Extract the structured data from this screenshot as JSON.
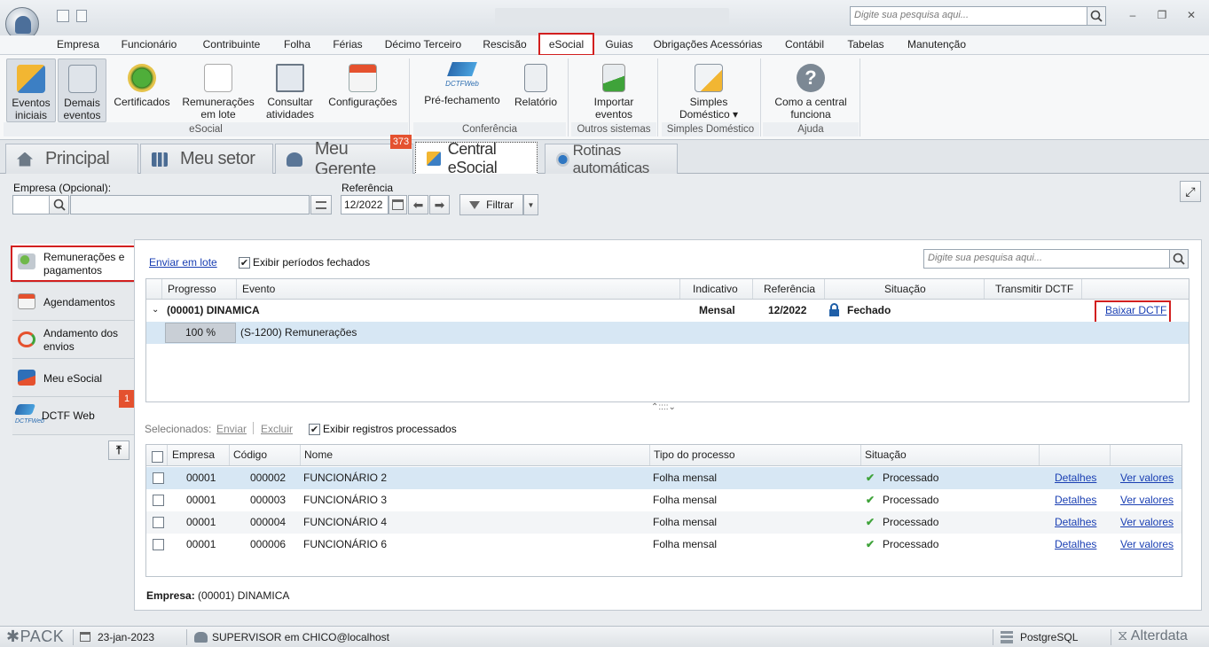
{
  "titlebar": {
    "search_placeholder": "Digite sua pesquisa aqui...",
    "window_buttons": [
      "–",
      "❐",
      "✕"
    ]
  },
  "menubar": {
    "items": [
      "Empresa",
      "Funcionário",
      "Contribuinte",
      "Folha",
      "Férias",
      "Décimo Terceiro",
      "Rescisão",
      "eSocial",
      "Guias",
      "Obrigações Acessórias",
      "Contábil",
      "Tabelas",
      "Manutenção"
    ],
    "active": "eSocial"
  },
  "ribbon": {
    "buttons": [
      {
        "l1": "Eventos",
        "l2": "iniciais"
      },
      {
        "l1": "Demais",
        "l2": "eventos"
      },
      {
        "l1": "Certificados",
        "l2": ""
      },
      {
        "l1": "Remunerações",
        "l2": "em lote"
      },
      {
        "l1": "Consultar",
        "l2": "atividades"
      },
      {
        "l1": "Configurações",
        "l2": ""
      },
      {
        "l1": "Pré-fechamento",
        "l2": ""
      },
      {
        "l1": "Relatório",
        "l2": ""
      },
      {
        "l1": "Importar",
        "l2": "eventos"
      },
      {
        "l1": "Simples",
        "l2": "Doméstico ▾"
      },
      {
        "l1": "Como a central",
        "l2": "funciona"
      }
    ],
    "dctf_web_logo": "DCTFWeb",
    "groups": [
      "eSocial",
      "Conferência",
      "Outros sistemas",
      "Simples Doméstico",
      "Ajuda"
    ]
  },
  "tabs": {
    "items": [
      "Principal",
      "Meu setor",
      "Meu Gerente",
      "Central eSocial",
      "Rotinas automáticas"
    ],
    "gerente_badge": "373",
    "active": "Central eSocial"
  },
  "filters": {
    "empresa_label": "Empresa (Opcional):",
    "referencia_label": "Referência",
    "referencia_value": "12/2022",
    "filtrar_label": "Filtrar"
  },
  "sidebar": {
    "items": [
      {
        "l1": "Remunerações e",
        "l2": "pagamentos"
      },
      {
        "l1": "Agendamentos",
        "l2": ""
      },
      {
        "l1": "Andamento dos",
        "l2": "envios"
      },
      {
        "l1": "Meu eSocial",
        "l2": ""
      },
      {
        "l1": "DCTF Web",
        "l2": ""
      }
    ],
    "dctf_badge": "1",
    "dctf_logo": "DCTFWeb"
  },
  "top_grid": {
    "enviar_lote": "Enviar em lote",
    "exibir_fechados": "Exibir períodos fechados",
    "search_placeholder": "Digite sua pesquisa aqui...",
    "headers": [
      "Progresso",
      "Evento",
      "Indicativo",
      "Referência",
      "Situação",
      "Transmitir DCTF"
    ],
    "group_row": {
      "evento": "(00001) DINAMICA",
      "indicativo": "Mensal",
      "referencia": "12/2022",
      "situacao": "Fechado",
      "acao": "Baixar DCTF"
    },
    "child_row": {
      "progresso": "100 %",
      "evento": "(S-1200) Remunerações"
    },
    "splitter": "⌃::::⌄"
  },
  "bottom_grid": {
    "selecionados": "Selecionados:",
    "enviar": "Enviar",
    "excluir": "Excluir",
    "exibir_processados": "Exibir registros processados",
    "headers": [
      "Empresa",
      "Código",
      "Nome",
      "Tipo do processo",
      "Situação"
    ],
    "rows": [
      {
        "empresa": "00001",
        "codigo": "000002",
        "nome": "FUNCIONÁRIO 2",
        "tipo": "Folha mensal",
        "situacao": "Processado",
        "detalhes": "Detalhes",
        "ver": "Ver valores"
      },
      {
        "empresa": "00001",
        "codigo": "000003",
        "nome": "FUNCIONÁRIO 3",
        "tipo": "Folha mensal",
        "situacao": "Processado",
        "detalhes": "Detalhes",
        "ver": "Ver valores"
      },
      {
        "empresa": "00001",
        "codigo": "000004",
        "nome": "FUNCIONÁRIO 4",
        "tipo": "Folha mensal",
        "situacao": "Processado",
        "detalhes": "Detalhes",
        "ver": "Ver valores"
      },
      {
        "empresa": "00001",
        "codigo": "000006",
        "nome": "FUNCIONÁRIO 6",
        "tipo": "Folha mensal",
        "situacao": "Processado",
        "detalhes": "Detalhes",
        "ver": "Ver valores"
      }
    ],
    "footer_label": "Empresa:",
    "footer_value": "(00001) DINAMICA"
  },
  "statusbar": {
    "logo": "PACK",
    "date": "23-jan-2023",
    "user": "SUPERVISOR em CHICO@localhost",
    "db": "PostgreSQL",
    "brand": "Alterdata"
  },
  "colors": {
    "highlight_red": "#d21f1f",
    "link_blue": "#1a3fb3",
    "selected_row": "#d7e7f4",
    "badge_orange": "#e4512f"
  }
}
